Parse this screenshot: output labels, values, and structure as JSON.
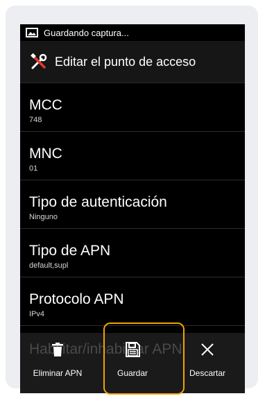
{
  "status_bar": {
    "text": "Guardando captura...",
    "icon": "picture-icon"
  },
  "action_bar": {
    "title": "Editar el punto de acceso",
    "icon": "tools-icon"
  },
  "settings": [
    {
      "title": "MCC",
      "value": "748"
    },
    {
      "title": "MNC",
      "value": "01"
    },
    {
      "title": "Tipo de autenticación",
      "value": "Ninguno"
    },
    {
      "title": "Tipo de APN",
      "value": "default,supl"
    },
    {
      "title": "Protocolo APN",
      "value": "IPv4"
    }
  ],
  "partially_hidden_item": "Habilitar/inhabilitar APN",
  "bottom_bar": {
    "delete_label": "Eliminar APN",
    "save_label": "Guardar",
    "discard_label": "Descartar"
  },
  "colors": {
    "highlight": "#f0a400",
    "background": "#000000",
    "text": "#ffffff"
  }
}
